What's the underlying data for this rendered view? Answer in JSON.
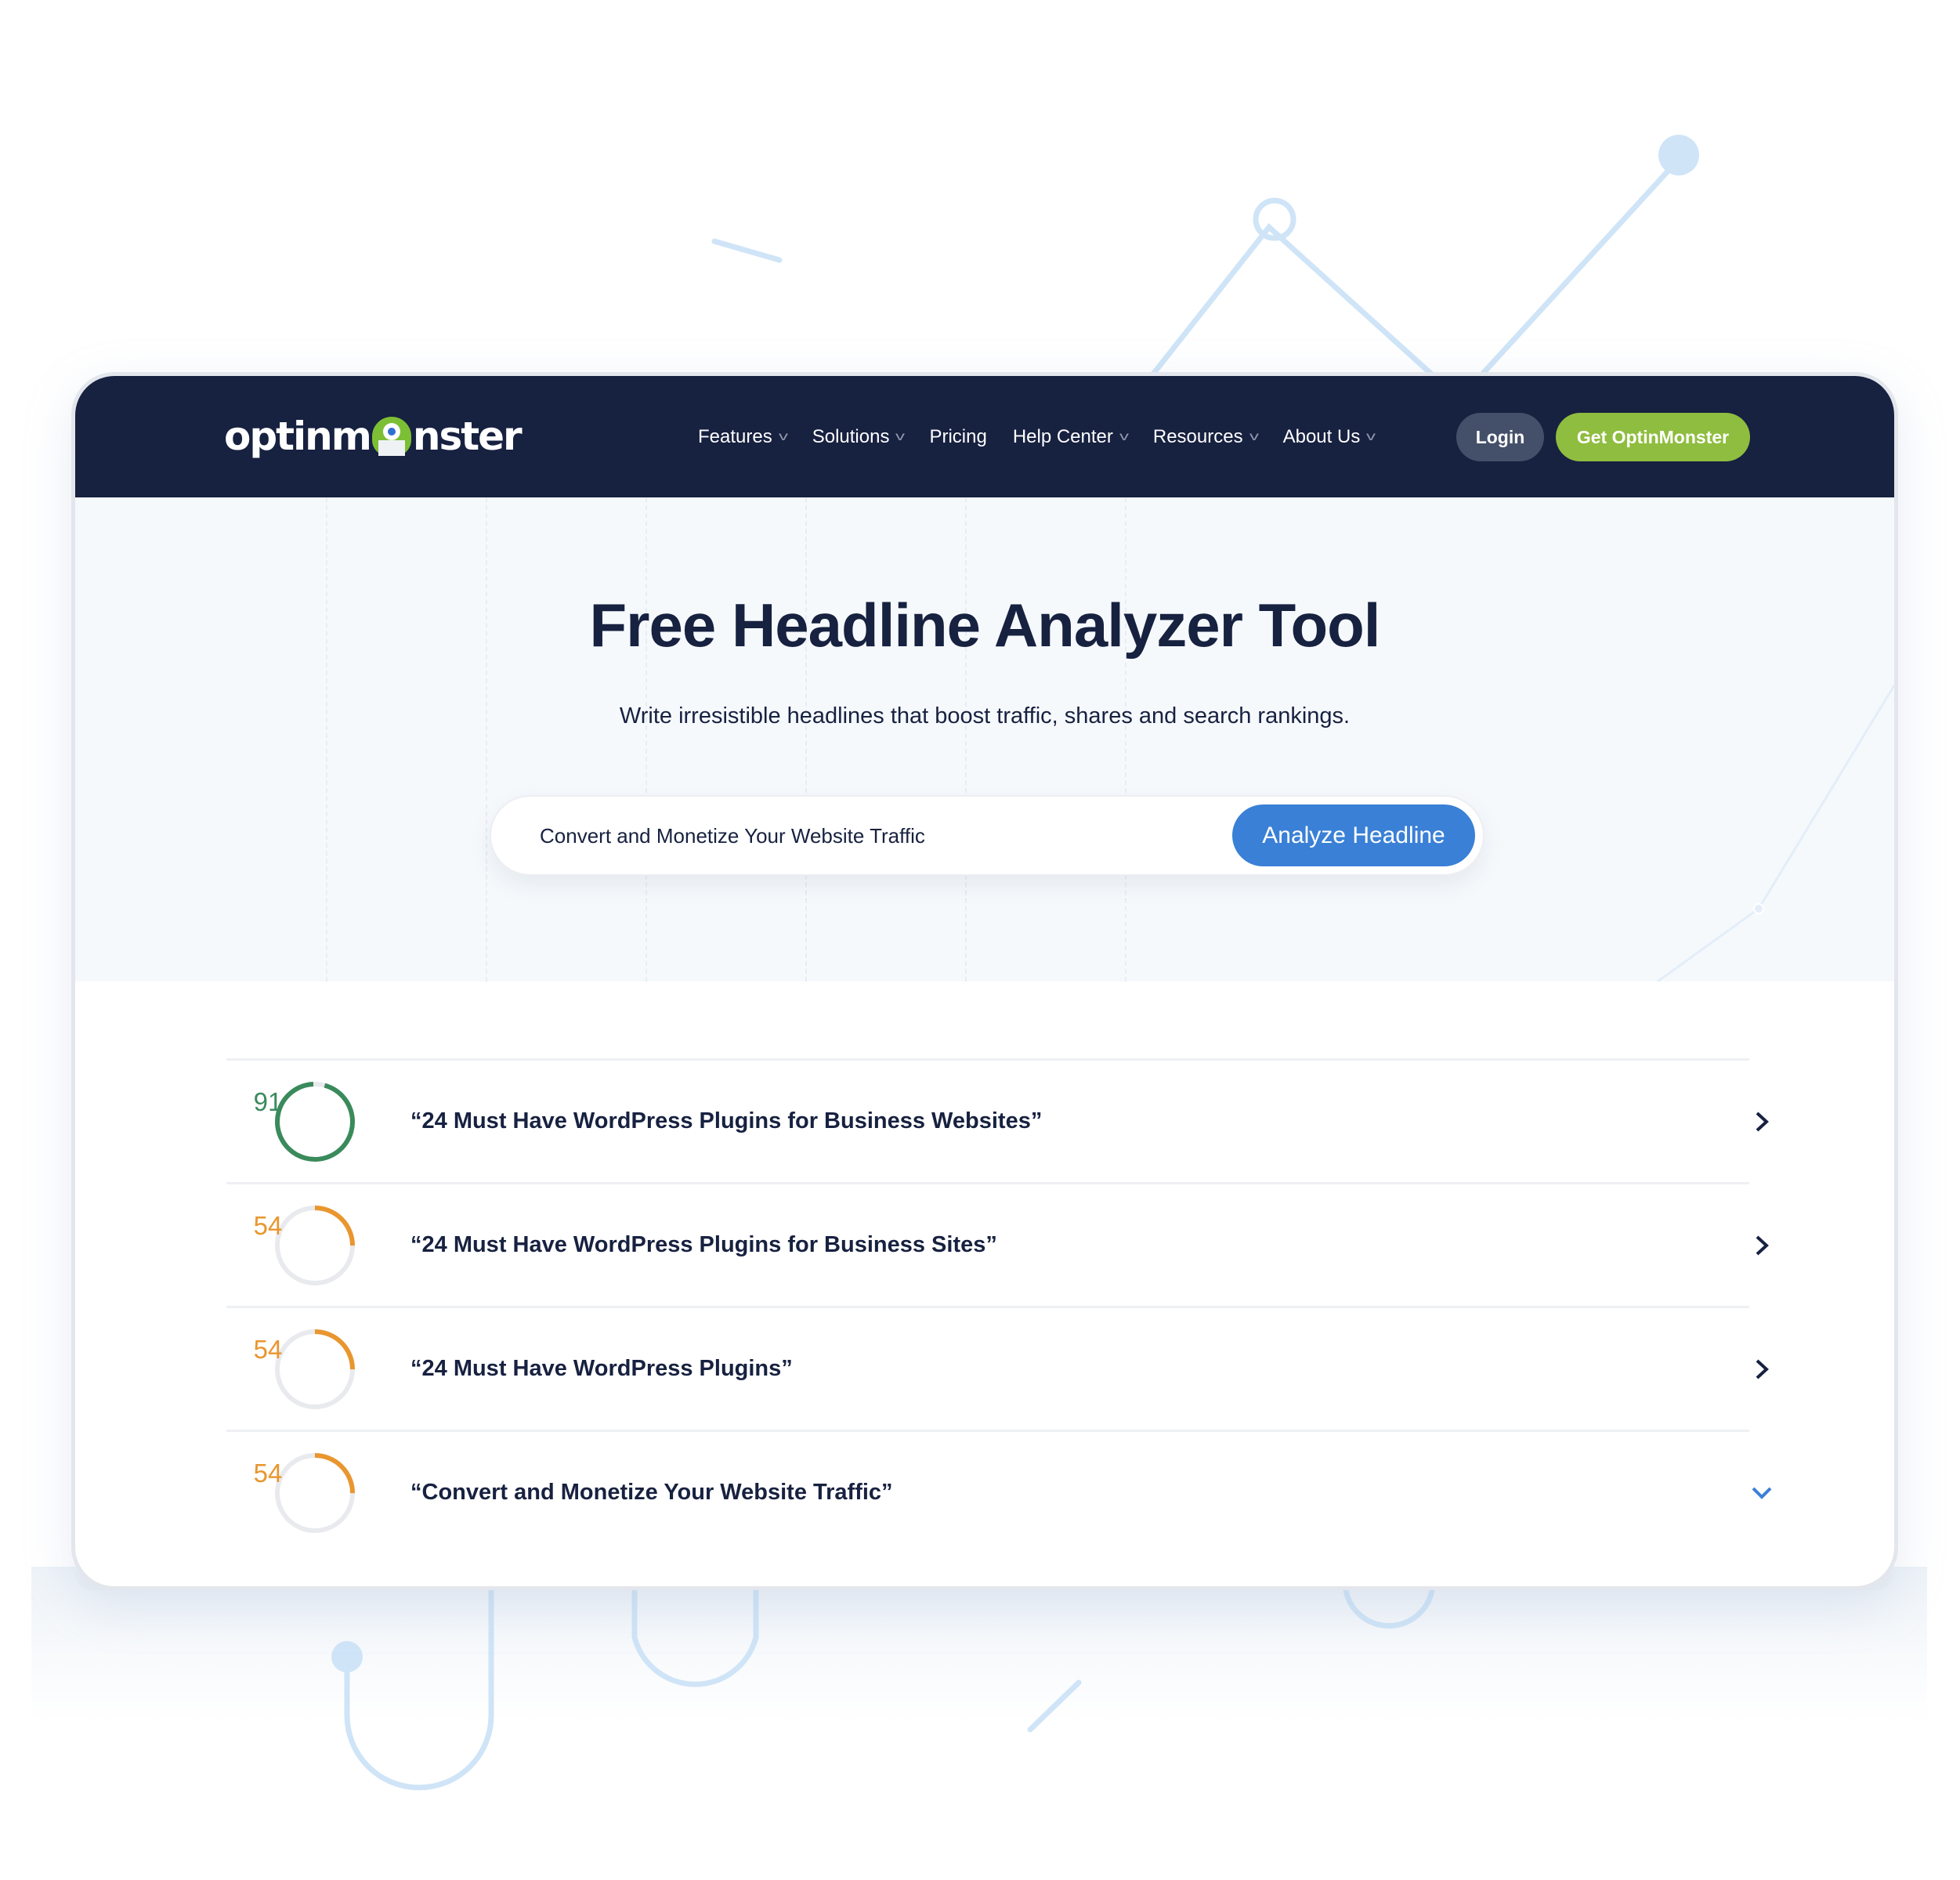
{
  "colors": {
    "header_bg": "#172140",
    "accent_blue": "#3a80d6",
    "cta_green": "#8fbd3f",
    "score_good": "#3a8a5c",
    "score_mid": "#e9962f",
    "decoration": "#cfe4f7"
  },
  "header": {
    "logo_text_left": "optinm",
    "logo_text_right": "nster",
    "logo_icon": "monster-icon",
    "nav": [
      {
        "label": "Features",
        "has_dropdown": true
      },
      {
        "label": "Solutions",
        "has_dropdown": true
      },
      {
        "label": "Pricing",
        "has_dropdown": false
      },
      {
        "label": "Help Center",
        "has_dropdown": true
      },
      {
        "label": "Resources",
        "has_dropdown": true
      },
      {
        "label": "About Us",
        "has_dropdown": true
      }
    ],
    "login_label": "Login",
    "cta_label": "Get OptinMonster"
  },
  "hero": {
    "title": "Free Headline Analyzer Tool",
    "subtitle": "Write irresistible headlines that boost traffic, shares and search rankings.",
    "search_value": "Convert and Monetize Your Website Traffic",
    "button_label": "Analyze Headline"
  },
  "results": [
    {
      "score": "91",
      "arc_fraction": 0.95,
      "status": "good",
      "headline": "“24 Must Have WordPress Plugins for Business Websites”",
      "expanded": false
    },
    {
      "score": "54",
      "arc_fraction": 0.25,
      "status": "mid",
      "headline": "“24 Must Have WordPress Plugins for Business Sites”",
      "expanded": false
    },
    {
      "score": "54",
      "arc_fraction": 0.25,
      "status": "mid",
      "headline": "“24 Must Have WordPress Plugins”",
      "expanded": false
    },
    {
      "score": "54",
      "arc_fraction": 0.25,
      "status": "mid",
      "headline": "“Convert and Monetize Your Website Traffic”",
      "expanded": true
    }
  ]
}
